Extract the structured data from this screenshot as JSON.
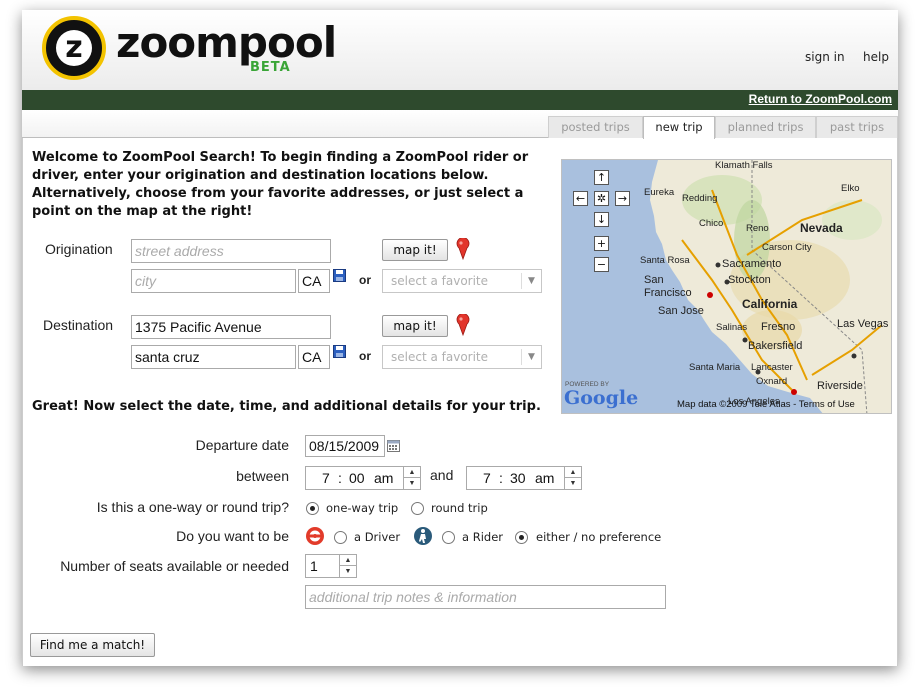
{
  "header": {
    "logo_letter": "z",
    "logo_text": "zoompool",
    "logo_badge": "BETA",
    "sign_in": "sign in",
    "help": "help"
  },
  "navbar": {
    "return_link": "Return to ZoomPool.com"
  },
  "tabs": [
    {
      "label": "posted trips",
      "active": false
    },
    {
      "label": "new trip",
      "active": true
    },
    {
      "label": "planned trips",
      "active": false
    },
    {
      "label": "past trips",
      "active": false
    }
  ],
  "intro": "Welcome to ZoomPool Search! To begin finding a ZoomPool rider or driver, enter your origination and destination locations below. Alternatively, choose from your favorite addresses, or just select a point on the map at the right!",
  "origination": {
    "label": "Origination",
    "street_placeholder": "street address",
    "street_value": "",
    "city_placeholder": "city",
    "city_value": "",
    "state": "CA",
    "map_button": "map it!",
    "or": "or",
    "favorite_placeholder": "select a favorite"
  },
  "destination": {
    "label": "Destination",
    "street_value": "1375 Pacific Avenue",
    "city_value": "santa cruz",
    "state": "CA",
    "map_button": "map it!",
    "or": "or",
    "favorite_placeholder": "select a favorite"
  },
  "map": {
    "labels": {
      "klamath_falls": "Klamath Falls",
      "eureka": "Eureka",
      "redding": "Redding",
      "elko": "Elko",
      "chico": "Chico",
      "reno": "Reno",
      "nevada": "Nevada",
      "carson_city": "Carson City",
      "santa_rosa": "Santa Rosa",
      "sacramento": "Sacramento",
      "san_francisco": "San Francisco",
      "stockton": "Stockton",
      "california": "California",
      "san_jose": "San Jose",
      "salinas": "Salinas",
      "fresno": "Fresno",
      "las_vegas": "Las Vegas",
      "bakersfield": "Bakersfield",
      "santa_maria": "Santa Maria",
      "lancaster": "Lancaster",
      "oxnard": "Oxnard",
      "riverside": "Riverside",
      "los_angeles": "Los Angeles"
    },
    "powered_by": "POWERED BY",
    "google": "Google",
    "copyright": "Map data ©2009 Tele Atlas - Terms of Use"
  },
  "section2_title": "Great! Now select the date, time, and additional details for your trip.",
  "departure": {
    "label": "Departure date",
    "value": "08/15/2009"
  },
  "between": {
    "label": "between",
    "start": {
      "hour": "7",
      "minute": "00",
      "ampm": "am"
    },
    "and": "and",
    "end": {
      "hour": "7",
      "minute": "30",
      "ampm": "am"
    }
  },
  "trip_type": {
    "label": "Is this a one-way or round trip?",
    "options": [
      "one-way trip",
      "round trip"
    ],
    "selected": "one-way trip"
  },
  "role": {
    "label": "Do you want to be",
    "options": [
      "a Driver",
      "a Rider",
      "either / no preference"
    ],
    "selected": "either / no preference"
  },
  "seats": {
    "label": "Number of seats available or needed",
    "value": "1"
  },
  "notes_placeholder": "additional trip notes & information",
  "submit": "Find me a match!",
  "colors": {
    "navbar": "#2e4a2d",
    "logo_ring": "#f3c300",
    "beta_green": "#3aa537",
    "pin_red": "#e2352b",
    "driver_red": "#e23b2a",
    "rider_blue": "#2a5a7a"
  }
}
